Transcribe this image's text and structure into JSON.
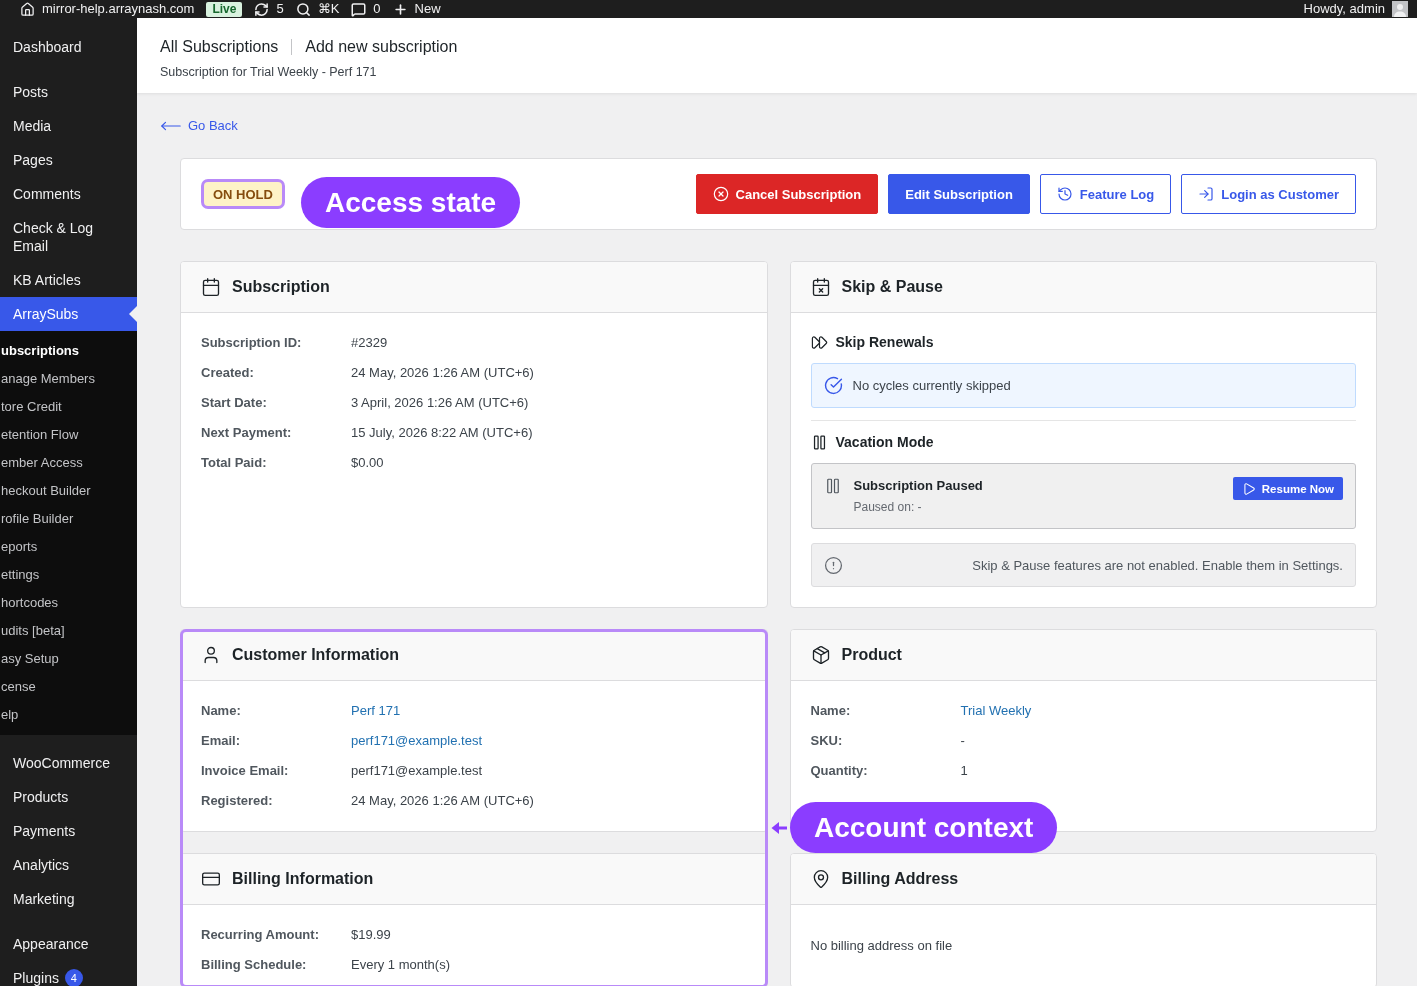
{
  "admin_bar": {
    "site": "mirror-help.arraynash.com",
    "environment": "Live",
    "updates": "5",
    "search_shortcut": "⌘K",
    "comments": "0",
    "new_label": "New",
    "greeting": "Howdy, admin"
  },
  "sidebar": {
    "groups": [
      {
        "items": [
          {
            "label": "Dashboard",
            "selected": false
          }
        ]
      },
      {
        "items": [
          {
            "label": "Posts",
            "selected": false
          },
          {
            "label": "Media",
            "selected": false
          },
          {
            "label": "Pages",
            "selected": false
          },
          {
            "label": "Comments",
            "selected": false
          },
          {
            "label": "Check & Log Email",
            "selected": false
          },
          {
            "label": "KB Articles",
            "selected": false
          },
          {
            "label": "ArraySubs",
            "selected": true,
            "children": [
              {
                "label": "ubscriptions",
                "selected": true
              },
              {
                "label": "anage Members",
                "selected": false
              },
              {
                "label": "tore Credit",
                "selected": false
              },
              {
                "label": "etention Flow",
                "selected": false
              },
              {
                "label": "ember Access",
                "selected": false
              },
              {
                "label": "heckout Builder",
                "selected": false
              },
              {
                "label": "rofile Builder",
                "selected": false
              },
              {
                "label": "eports",
                "selected": false
              },
              {
                "label": "ettings",
                "selected": false
              },
              {
                "label": "hortcodes",
                "selected": false
              },
              {
                "label": "udits [beta]",
                "selected": false
              },
              {
                "label": "asy Setup",
                "selected": false
              },
              {
                "label": "cense",
                "selected": false
              },
              {
                "label": "elp",
                "selected": false
              }
            ]
          }
        ]
      },
      {
        "items": [
          {
            "label": "WooCommerce",
            "selected": false
          },
          {
            "label": "Products",
            "selected": false
          },
          {
            "label": "Payments",
            "selected": false
          },
          {
            "label": "Analytics",
            "selected": false
          },
          {
            "label": "Marketing",
            "selected": false
          }
        ]
      },
      {
        "items": [
          {
            "label": "Appearance",
            "selected": false
          },
          {
            "label": "Plugins",
            "selected": false,
            "badge": "4"
          }
        ]
      }
    ]
  },
  "header": {
    "breadcrumbs": [
      {
        "label": "All Subscriptions"
      },
      {
        "label": "Add new subscription"
      }
    ],
    "subtitle": "Subscription for Trial Weekly - Perf 171"
  },
  "back_link": "Go Back",
  "status_bar": {
    "badge": "ON HOLD",
    "highlighted": true,
    "callout": "Access state",
    "actions": [
      {
        "label": "Cancel Subscription",
        "kind": "danger"
      },
      {
        "label": "Edit Subscription",
        "kind": "primary"
      },
      {
        "label": "Feature Log",
        "kind": "outline"
      },
      {
        "label": "Login as Customer",
        "kind": "outline"
      }
    ]
  },
  "subscription": {
    "title": "Subscription",
    "rows": [
      {
        "label": "Subscription ID:",
        "value": "#2329",
        "link": false
      },
      {
        "label": "Created:",
        "value": "24 May, 2026 1:26 AM (UTC+6)",
        "link": false
      },
      {
        "label": "Start Date:",
        "value": "3 April, 2026 1:26 AM (UTC+6)",
        "link": false
      },
      {
        "label": "Next Payment:",
        "value": "15 July, 2026 8:22 AM (UTC+6)",
        "link": false
      },
      {
        "label": "Total Paid:",
        "value": "$0.00",
        "link": false
      }
    ]
  },
  "skip_pause": {
    "title": "Skip & Pause",
    "skip_renewals": {
      "heading": "Skip Renewals",
      "message": "No cycles currently skipped"
    },
    "vacation_mode": {
      "heading": "Vacation Mode",
      "status": "Subscription Paused",
      "paused_on": "Paused on: -",
      "action": "Resume Now"
    },
    "notice": "Skip & Pause features are not enabled. Enable them in Settings."
  },
  "customer_group": {
    "highlighted": true,
    "callout": "Account context"
  },
  "customer": {
    "title": "Customer Information",
    "rows": [
      {
        "label": "Name:",
        "value": "Perf 171",
        "link": true
      },
      {
        "label": "Email:",
        "value": "perf171@example.test",
        "link": true
      },
      {
        "label": "Invoice Email:",
        "value": "perf171@example.test",
        "link": false
      },
      {
        "label": "Registered:",
        "value": "24 May, 2026 1:26 AM (UTC+6)",
        "link": false
      }
    ]
  },
  "product": {
    "title": "Product",
    "rows": [
      {
        "label": "Name:",
        "value": "Trial Weekly",
        "link": true
      },
      {
        "label": "SKU:",
        "value": "-",
        "link": false
      },
      {
        "label": "Quantity:",
        "value": "1",
        "link": false
      }
    ]
  },
  "billing": {
    "title": "Billing Information",
    "rows": [
      {
        "label": "Recurring Amount:",
        "value": "$19.99",
        "link": false
      },
      {
        "label": "Billing Schedule:",
        "value": "Every 1 month(s)",
        "link": false
      }
    ]
  },
  "billing_address": {
    "title": "Billing Address",
    "message": "No billing address on file"
  }
}
